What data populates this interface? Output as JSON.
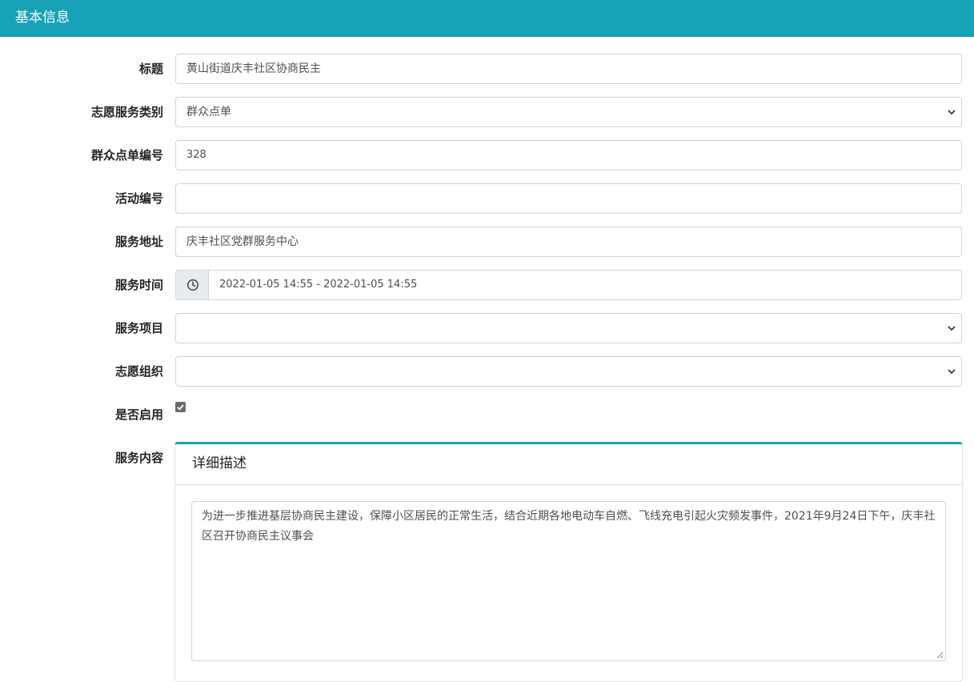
{
  "header": {
    "title": "基本信息"
  },
  "form": {
    "title": {
      "label": "标题",
      "value": "黄山街道庆丰社区协商民主"
    },
    "category": {
      "label": "志愿服务类别",
      "value": "群众点单"
    },
    "order_no": {
      "label": "群众点单编号",
      "value": "328"
    },
    "activity_no": {
      "label": "活动编号",
      "value": ""
    },
    "address": {
      "label": "服务地址",
      "value": "庆丰社区党群服务中心"
    },
    "time": {
      "label": "服务时间",
      "value": "2022-01-05 14:55 - 2022-01-05 14:55",
      "icon": "clock-icon"
    },
    "project": {
      "label": "服务项目",
      "value": ""
    },
    "organization": {
      "label": "志愿组织",
      "value": ""
    },
    "enabled": {
      "label": "是否启用",
      "checked": true
    },
    "content": {
      "label": "服务内容",
      "card_title": "详细描述",
      "value": "为进一步推进基层协商民主建设，保障小区居民的正常生活，结合近期各地电动车自燃、飞线充电引起火灾频发事件，2021年9月24日下午，庆丰社区召开协商民主议事会"
    }
  },
  "colors": {
    "accent": "#17a2b8",
    "border": "#ced4da",
    "addon_bg": "#e9ecef"
  }
}
